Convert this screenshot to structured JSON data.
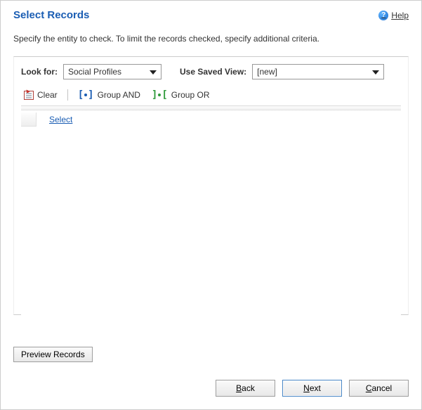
{
  "header": {
    "title": "Select Records",
    "help_label": "Help"
  },
  "description": "Specify the entity to check. To limit the records checked, specify additional criteria.",
  "controls": {
    "look_for_label": "Look for:",
    "look_for_value": "Social Profiles",
    "saved_view_label": "Use Saved View:",
    "saved_view_value": "[new]"
  },
  "toolbar": {
    "clear_label": "Clear",
    "group_and_label": "Group AND",
    "group_or_label": "Group OR"
  },
  "grid": {
    "select_link": "Select"
  },
  "buttons": {
    "preview_label": "Preview Records",
    "back_label_pre": "",
    "back_key": "B",
    "back_label_post": "ack",
    "next_label_pre": "",
    "next_key": "N",
    "next_label_post": "ext",
    "cancel_label_pre": "",
    "cancel_key": "C",
    "cancel_label_post": "ancel"
  }
}
